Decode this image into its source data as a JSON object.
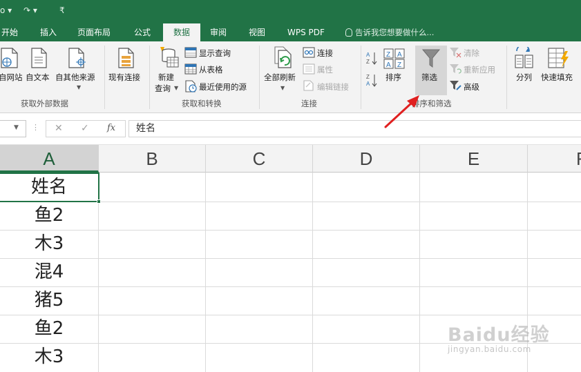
{
  "quick_access": {
    "item1": "o ▾",
    "item2": "↷ ▾",
    "item3": "₹"
  },
  "tabs": [
    "开始",
    "插入",
    "页面布局",
    "公式",
    "数据",
    "审阅",
    "视图",
    "WPS PDF"
  ],
  "active_tab_index": 4,
  "tell_me": "告诉我您想要做什么...",
  "ribbon": {
    "get_external": {
      "label": "获取外部数据",
      "from_web": "自网站",
      "from_text": "自文本",
      "from_other": "自其他来源",
      "existing": "现有连接"
    },
    "get_transform": {
      "label": "获取和转换",
      "new_query_line1": "新建",
      "new_query_line2": "查询",
      "show_queries": "显示查询",
      "from_table": "从表格",
      "recent_sources": "最近使用的源"
    },
    "connections": {
      "label": "连接",
      "refresh_all": "全部刷新",
      "connections": "连接",
      "properties": "属性",
      "edit_links": "编辑链接"
    },
    "sort_filter": {
      "label": "排序和筛选",
      "sort": "排序",
      "filter": "筛选",
      "clear": "清除",
      "reapply": "重新应用",
      "advanced": "高级"
    },
    "data_tools": {
      "text_to_columns": "分列",
      "flash_fill": "快速填充"
    }
  },
  "formula_bar": {
    "cancel": "✕",
    "enter": "✓",
    "fx": "fx",
    "content": "姓名"
  },
  "grid": {
    "columns": [
      "A",
      "B",
      "C",
      "D",
      "E",
      "F"
    ],
    "column_a_values": [
      "姓名",
      "鱼2",
      "木3",
      "混4",
      "猪5",
      "鱼2",
      "木3"
    ]
  },
  "watermark": {
    "logo": "Baidu经验",
    "url": "jingyan.baidu.com"
  },
  "colors": {
    "excel_green": "#217346",
    "ribbon_bg": "#f3f3f3",
    "arrow_red": "#e02020"
  }
}
